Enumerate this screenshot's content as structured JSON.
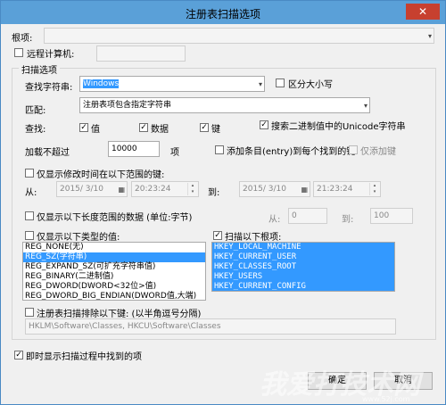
{
  "window": {
    "title": "注册表扫描选项",
    "close_glyph": "✕"
  },
  "root_key": {
    "label": "根项:",
    "value": ""
  },
  "remote": {
    "label": "远程计算机:",
    "value": ""
  },
  "scan_group": {
    "label": "扫描选项"
  },
  "find": {
    "label": "查找字符串:",
    "value": "Windows",
    "case_label": "区分大小写"
  },
  "match": {
    "label": "匹配:",
    "value": "注册表项包含指定字符串"
  },
  "lookin": {
    "label": "查找:",
    "value_label": "值",
    "data_label": "数据",
    "key_label": "键",
    "unicode_label": "搜索二进制值中的Unicode字符串"
  },
  "limit": {
    "label": "加载不超过",
    "value": "10000",
    "unit": "项",
    "add_entry_label": "添加条目(entry)到每个找到的键",
    "only_add_label": "仅添加键"
  },
  "time_filter": {
    "label": "仅显示修改时间在以下范围的键:",
    "from_label": "从:",
    "to_label": "到:",
    "from_date": "2015/ 3/10",
    "from_time": "20:23:24",
    "to_date": "2015/ 3/10",
    "to_time": "21:23:24"
  },
  "length_filter": {
    "label": "仅显示以下长度范围的数据 (单位:字节)",
    "from_label": "从:",
    "from_value": "0",
    "to_label": "到:",
    "to_value": "100"
  },
  "type_filter": {
    "label": "仅显示以下类型的值:",
    "items": [
      "REG_NONE(无)",
      "REG_SZ(字符串)",
      "REG_EXPAND_SZ(可扩充字符串值)",
      "REG_BINARY(二进制值)",
      "REG_DWORD(DWORD<32位>值)",
      "REG_DWORD_BIG_ENDIAN(DWORD值,大端)"
    ]
  },
  "roots": {
    "label": "扫描以下根项:",
    "items": [
      "HKEY_LOCAL_MACHINE",
      "HKEY_CURRENT_USER",
      "HKEY_CLASSES_ROOT",
      "HKEY_USERS",
      "HKEY_CURRENT_CONFIG"
    ]
  },
  "exclude": {
    "label": "注册表扫描排除以下键: (以半角逗号分隔)",
    "value": "HKLM\\Software\\Classes, HKCU\\Software\\Classes"
  },
  "realtime": {
    "label": "即时显示扫描过程中找到的项"
  },
  "buttons": {
    "ok": "确定",
    "cancel": "取消"
  },
  "glyphs": {
    "check": "✓",
    "down": "▾",
    "up": "▴",
    "calendar": "▦"
  },
  "watermark": {
    "text": "我爱打技术网",
    "sub": "www.52j.com"
  }
}
